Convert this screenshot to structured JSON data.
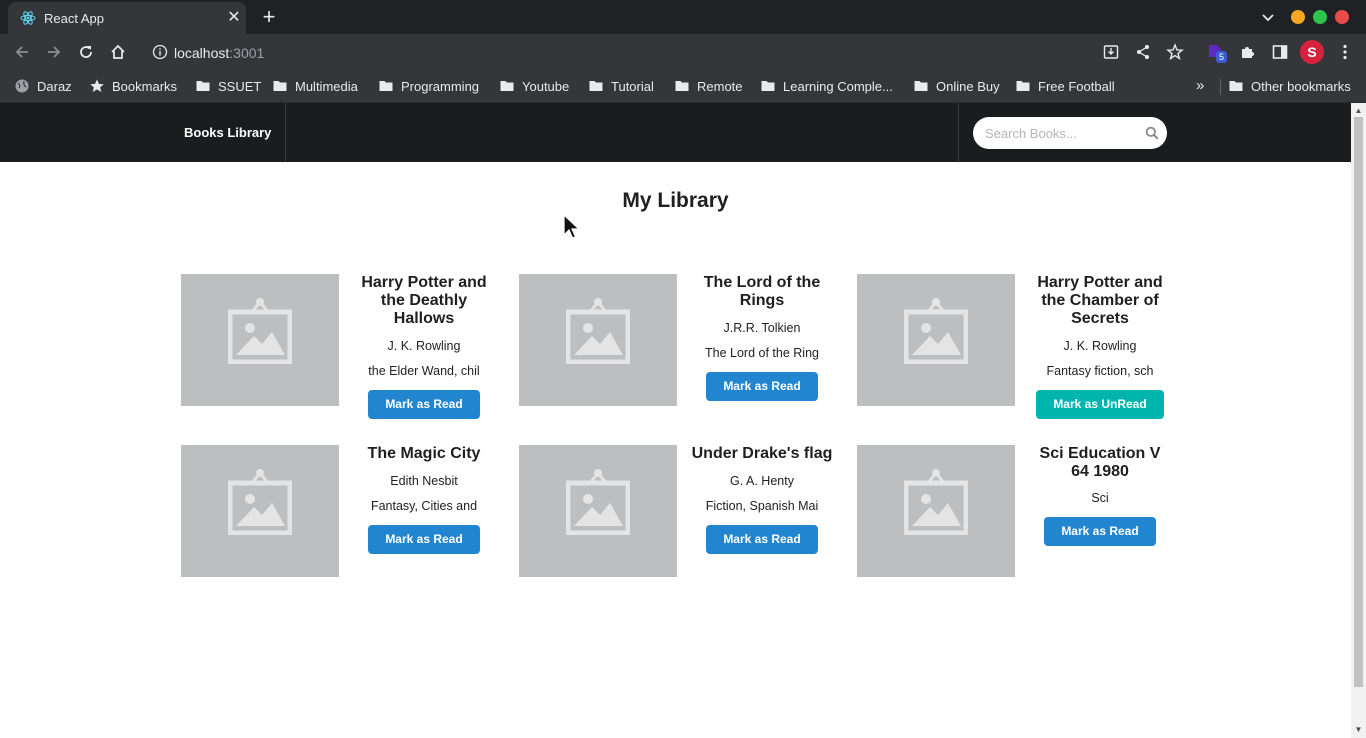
{
  "browser": {
    "tab_title": "React App",
    "url_host": "localhost",
    "url_port": ":3001",
    "extension_badge": "5",
    "profile_initial": "S",
    "bookmarks": [
      "Daraz",
      "Bookmarks",
      "SSUET",
      "Multimedia",
      "Programming",
      "Youtube",
      "Tutorial",
      "Remote",
      "Learning Comple...",
      "Online Buy",
      "Free Football"
    ],
    "other_bookmarks": "Other bookmarks",
    "colors": {
      "chrome_dark": "#202124",
      "chrome_toolbar": "#35363a",
      "minimize": "#f5a623",
      "maximize": "#2ec44a",
      "close": "#e94b4b",
      "profile": "#d6223c",
      "extension": "#5b2bbd"
    }
  },
  "app": {
    "brand": "Books Library",
    "search_placeholder": "Search Books...",
    "heading": "My Library",
    "books": [
      {
        "title": "Harry Potter and the Deathly Hallows",
        "author": "J. K. Rowling",
        "description": "the Elder Wand, chil",
        "action": "Mark as Read",
        "status": "unread"
      },
      {
        "title": "The Lord of the Rings",
        "author": "J.R.R. Tolkien",
        "description": "The Lord of the Ring",
        "action": "Mark as Read",
        "status": "unread"
      },
      {
        "title": "Harry Potter and the Chamber of Secrets",
        "author": "J. K. Rowling",
        "description": "Fantasy fiction, sch",
        "action": "Mark as UnRead",
        "status": "read"
      },
      {
        "title": "The Magic City",
        "author": "Edith Nesbit",
        "description": "Fantasy, Cities and",
        "action": "Mark as Read",
        "status": "unread"
      },
      {
        "title": "Under Drake's flag",
        "author": "G. A. Henty",
        "description": "Fiction, Spanish Mai",
        "action": "Mark as Read",
        "status": "unread"
      },
      {
        "title": "Sci Education V 64 1980",
        "author": "",
        "description": "Sci",
        "action": "Mark as Read",
        "status": "unread"
      }
    ],
    "colors": {
      "navbar": "#1b1c1d",
      "button_read": "#2185d0",
      "button_unread": "#00b5ad",
      "cover_placeholder": "#bdbebf"
    }
  }
}
